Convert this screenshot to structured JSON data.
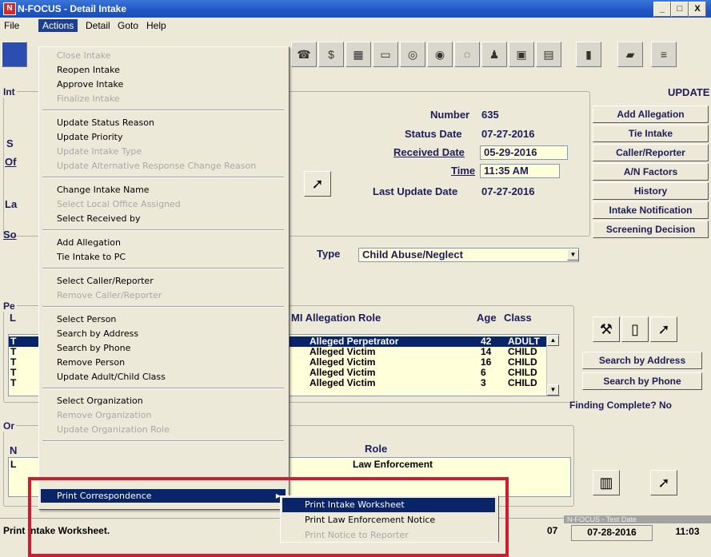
{
  "window": {
    "title": "N-FOCUS - Detail Intake",
    "app_icon": "N",
    "minimize": "_",
    "maximize": "□",
    "close": "X"
  },
  "menubar": {
    "items": [
      "File",
      "Actions",
      "Detail",
      "Goto",
      "Help"
    ]
  },
  "actions_menu": {
    "items": [
      {
        "label": "Close Intake",
        "enabled": false
      },
      {
        "label": "Reopen Intake",
        "enabled": true
      },
      {
        "label": "Approve Intake",
        "enabled": true
      },
      {
        "label": "Finalize Intake",
        "enabled": false
      },
      {
        "label": "Update Status Reason",
        "enabled": true
      },
      {
        "label": "Update Priority",
        "enabled": true
      },
      {
        "label": "Update Intake Type",
        "enabled": false
      },
      {
        "label": "Update Alternative Response Change Reason",
        "enabled": false
      },
      {
        "label": "Change Intake Name",
        "enabled": true
      },
      {
        "label": "Select Local Office Assigned",
        "enabled": false
      },
      {
        "label": "Select Received by",
        "enabled": true
      },
      {
        "label": "Add Allegation",
        "enabled": true
      },
      {
        "label": "Tie Intake to PC",
        "enabled": true
      },
      {
        "label": "Select Caller/Reporter",
        "enabled": true
      },
      {
        "label": "Remove Caller/Reporter",
        "enabled": false
      },
      {
        "label": "Select Person",
        "enabled": true
      },
      {
        "label": "Search by Address",
        "enabled": true
      },
      {
        "label": "Search by Phone",
        "enabled": true
      },
      {
        "label": "Remove Person",
        "enabled": true
      },
      {
        "label": "Update Adult/Child Class",
        "enabled": true
      },
      {
        "label": "Select Organization",
        "enabled": true
      },
      {
        "label": "Remove Organization",
        "enabled": false
      },
      {
        "label": "Update Organization Role",
        "enabled": false
      },
      {
        "label": "Print Correspondence",
        "enabled": true,
        "submenu_arrow": "▶"
      }
    ]
  },
  "print_submenu": {
    "items": [
      {
        "label": "Print Intake Worksheet",
        "enabled": true
      },
      {
        "label": "Print Law Enforcement Notice",
        "enabled": true
      },
      {
        "label": "Print Notice to Reporter",
        "enabled": false
      }
    ]
  },
  "header": {
    "update_label": "UPDATE"
  },
  "intake": {
    "number_label": "Number",
    "number": "635",
    "status_date_label": "Status Date",
    "status_date": "07-27-2016",
    "received_date_label": "Received Date",
    "received_date": "05-29-2016",
    "time_label": "Time",
    "time": "11:35 AM",
    "last_update_label": "Last Update Date",
    "last_update": "07-27-2016",
    "type_label": "Type",
    "type_value": "Child Abuse/Neglect"
  },
  "left_fragments": {
    "int": "Int",
    "s": "S",
    "of": "Of",
    "la": "La",
    "so": "So",
    "pe": "Pe",
    "l": "L",
    "or": "Or",
    "n": "N",
    "t": "T",
    "l2": "L"
  },
  "side_buttons": [
    "Add Allegation",
    "Tie Intake",
    "Caller/Reporter",
    "A/N Factors",
    "History",
    "Intake Notification",
    "Screening Decision"
  ],
  "persons": {
    "headers": {
      "role": "MI Allegation Role",
      "age": "Age",
      "class": "Class"
    },
    "rows": [
      {
        "role": "Alleged Perpetrator",
        "age": "42",
        "class": "ADULT"
      },
      {
        "role": "Alleged Victim",
        "age": "14",
        "class": "CHILD"
      },
      {
        "role": "Alleged Victim",
        "age": "16",
        "class": "CHILD"
      },
      {
        "role": "Alleged Victim",
        "age": "6",
        "class": "CHILD"
      },
      {
        "role": "Alleged Victim",
        "age": "3",
        "class": "CHILD"
      }
    ]
  },
  "person_buttons": {
    "search_address": "Search by Address",
    "search_phone": "Search by Phone"
  },
  "finding_complete": "Finding Complete? No",
  "organizations": {
    "role_header": "Role",
    "role_value": "Law Enforcement"
  },
  "status": {
    "message": "Print Intake Worksheet.",
    "env_label": "N-FOCUS - Test Date",
    "cut_text": "07",
    "date": "07-28-2016",
    "time": "11:03"
  },
  "colors": {
    "highlight": "#0a246a",
    "field_bg": "#ffffd9",
    "annotation_box": "#d01c2e"
  }
}
